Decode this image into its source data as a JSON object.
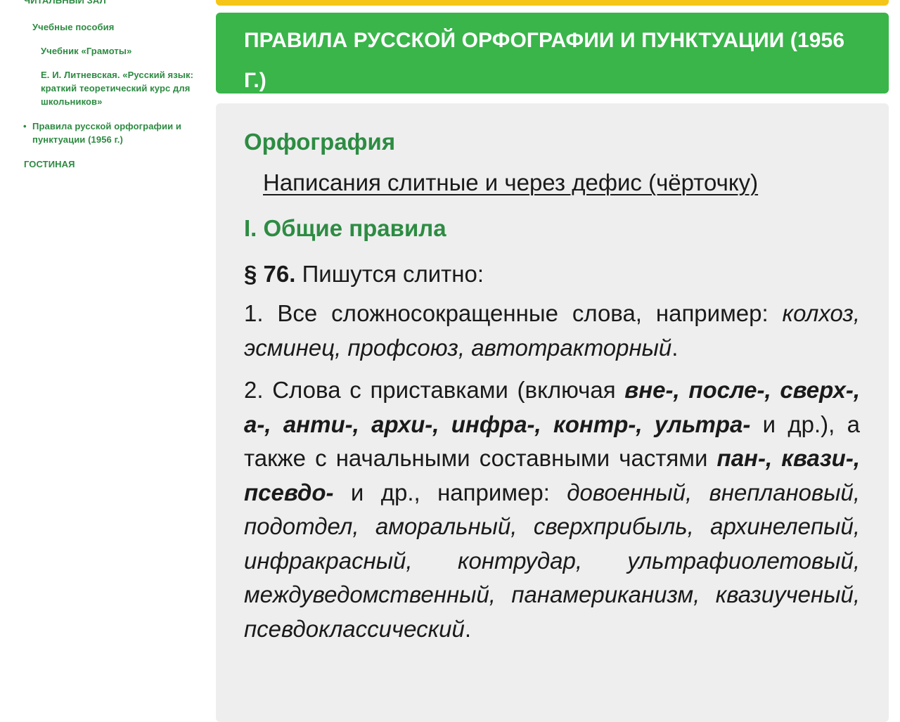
{
  "sidebar": {
    "section_top": "Читальный зал",
    "items": [
      {
        "label": "Учебные пособия",
        "level": 1
      },
      {
        "label": "Учебник «Грамоты»",
        "level": 2
      },
      {
        "label": "Е. И. Литневская. «Русский язык: краткий теоретический курс для школьников»",
        "level": 2
      },
      {
        "label": "Правила русской орфографии и пунктуации (1956 г.)",
        "level": 1,
        "active": true,
        "bullet": "•"
      }
    ],
    "section_bottom": "Гостиная"
  },
  "header": {
    "title": "Правила русской орфографии и пунктуации (1956 г.)"
  },
  "content": {
    "section_title": "Орфография",
    "subtitle": "Написания слитные и через дефис (чёрточку)",
    "rule_heading": "I. Общие правила",
    "paragraph": {
      "number": "§ 76.",
      "text": " Пишутся слитно:"
    },
    "item1": {
      "lead": "1. Все сложносокращенные слова, например: ",
      "examples": "колхоз, эсминец, профсоюз, автотракторный",
      "end": "."
    },
    "item2": {
      "lead": "2. Слова с приставками (включая ",
      "prefixes": "вне-, после-, сверх-, а-, анти-, архи-, инфра-, контр-, ультра-",
      "middle": " и др.), а также с начальными составными частями ",
      "parts": "пан-, квази-, псевдо-",
      "middle2": " и др., например: ",
      "examples": "довоенный, внеплановый, подотдел, аморальный, сверхприбыль, архинелепый, инфракрасный, контрудар, ультрафиолетовый, междуведомственный, панамериканизм, квазиученый, псевдоклассический",
      "end": "."
    }
  },
  "colors": {
    "brand_green": "#39b54a",
    "link_green": "#2c8a41",
    "accent_yellow": "#f5c518",
    "card_bg": "#eeeeef",
    "text": "#1a1a1a"
  }
}
